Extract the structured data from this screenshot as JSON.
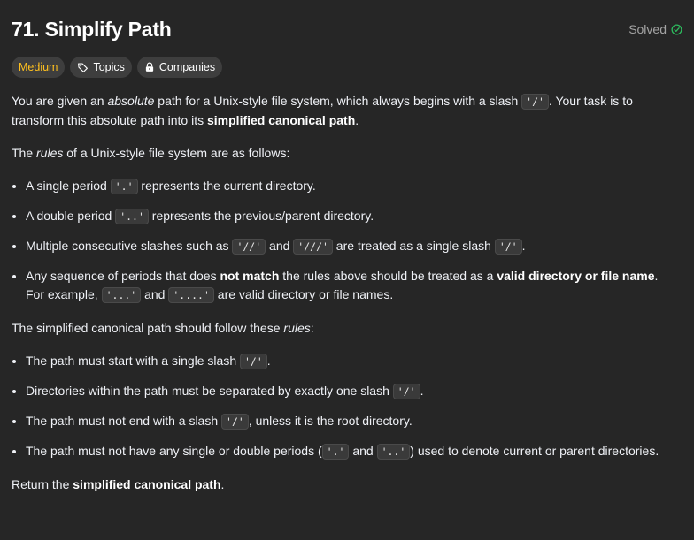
{
  "problem": {
    "title": "71. Simplify Path",
    "status": "Solved"
  },
  "tags": {
    "difficulty": "Medium",
    "topics": "Topics",
    "companies": "Companies"
  },
  "icons": {
    "solved": "check-circle-icon",
    "topics": "tag-icon",
    "companies": "lock-icon"
  },
  "colors": {
    "difficulty_medium": "#ffc01e",
    "solved_check": "#2cbb5d",
    "background": "#262626"
  },
  "description": {
    "p1": {
      "t1": "You are given an ",
      "em1": "absolute",
      "t2": " path for a Unix-style file system, which always begins with a slash ",
      "c1": "'/'",
      "t3": ". Your task is to transform this absolute path into its ",
      "b1": "simplified canonical path",
      "t4": "."
    },
    "p2": {
      "t1": "The ",
      "em1": "rules",
      "t2": " of a Unix-style file system are as follows:"
    },
    "rules": [
      {
        "t1": "A single period ",
        "c1": "'.'",
        "t2": " represents the current directory."
      },
      {
        "t1": "A double period ",
        "c1": "'..'",
        "t2": " represents the previous/parent directory."
      },
      {
        "t1": "Multiple consecutive slashes such as ",
        "c1": "'//'",
        "t2": " and ",
        "c2": "'///'",
        "t3": " are treated as a single slash ",
        "c3": "'/'",
        "t4": "."
      },
      {
        "t1": "Any sequence of periods that does ",
        "b1": "not match",
        "t2": " the rules above should be treated as a ",
        "b2": "valid directory or file name",
        "t3": ". For example, ",
        "c1": "'...'",
        "t4": " and ",
        "c2": "'....'",
        "t5": " are valid directory or file names."
      }
    ],
    "p3": {
      "t1": "The simplified canonical path should follow these ",
      "em1": "rules",
      "t2": ":"
    },
    "canonical_rules": [
      {
        "t1": "The path must start with a single slash ",
        "c1": "'/'",
        "t2": "."
      },
      {
        "t1": "Directories within the path must be separated by exactly one slash ",
        "c1": "'/'",
        "t2": "."
      },
      {
        "t1": "The path must not end with a slash ",
        "c1": "'/'",
        "t2": ", unless it is the root directory."
      },
      {
        "t1": "The path must not have any single or double periods (",
        "c1": "'.'",
        "t2": " and ",
        "c2": "'..'",
        "t3": ") used to denote current or parent directories."
      }
    ],
    "p4": {
      "t1": "Return the ",
      "b1": "simplified canonical path",
      "t2": "."
    }
  }
}
